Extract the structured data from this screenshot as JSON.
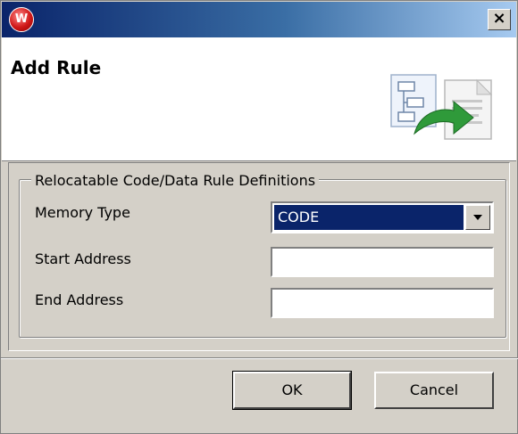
{
  "window": {
    "close_glyph": "×",
    "app_icon_letter": "W"
  },
  "header": {
    "title": "Add Rule"
  },
  "group": {
    "legend": "Relocatable Code/Data Rule Definitions",
    "memory_type": {
      "label": "Memory Type",
      "value": "CODE"
    },
    "start_address": {
      "label": "Start Address",
      "value": ""
    },
    "end_address": {
      "label": "End Address",
      "value": ""
    }
  },
  "buttons": {
    "ok": "OK",
    "cancel": "Cancel"
  },
  "colors": {
    "title_bar_start": "#0a246a",
    "selection": "#0a246a",
    "dialog_bg": "#d4d0c8"
  }
}
